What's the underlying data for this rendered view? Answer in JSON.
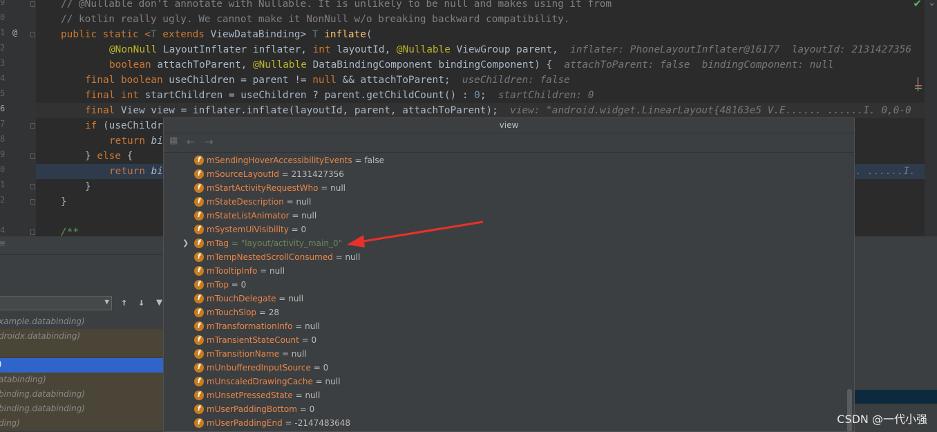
{
  "editor": {
    "line_numbers": [
      "9",
      "0",
      "1",
      "2",
      "3",
      "4",
      "5",
      "6",
      "7",
      "8",
      "9",
      "0",
      "1",
      "2",
      "3",
      "4"
    ],
    "gutter_marker": "@",
    "lines": {
      "l1": "// @Nullable don't annotate with Nullable. It is unlikely to be null and makes using it from",
      "l2": "// kotlin really ugly. We cannot make it NonNull w/o breaking backward compatibility.",
      "l3_a": "public static <",
      "l3_b": "T",
      "l3_c": " extends ",
      "l3_d": "ViewDataBinding> ",
      "l3_e": "T",
      "l3_f": " inflate",
      "l3_g": "(",
      "l4_a": "@NonNull",
      "l4_b": " LayoutInflater inflater, ",
      "l4_c": "int",
      "l4_d": " layoutId, ",
      "l4_e": "@Nullable",
      "l4_f": " ViewGroup parent,",
      "l4_hint": "inflater: PhoneLayoutInflater@16177  layoutId: 2131427356",
      "l5_a": "boolean",
      "l5_b": " attachToParent, ",
      "l5_c": "@Nullable",
      "l5_d": " DataBindingComponent bindingComponent) {",
      "l5_hint": "attachToParent: false  bindingComponent: null",
      "l6_a": "final boolean",
      "l6_b": " useChildren = parent != ",
      "l6_c": "null",
      "l6_d": " && attachToParent;",
      "l6_hint": "useChildren: false",
      "l7_a": "final int",
      "l7_b": " startChildren = useChildren ? parent.getChildCount() : ",
      "l7_c": "0",
      "l7_d": ";",
      "l7_hint": "startChildren: 0",
      "l8_a": "final",
      "l8_b": " View view = inflater.inflate(layoutId, parent, attachToParent);",
      "l8_hint": "view: \"android.widget.LinearLayout{48163e5 V.E...... ......I. 0,0-0",
      "l9_a": "if",
      "l9_b": " (useChildr",
      "l10_a": "return",
      "l10_b": " bi",
      "l11_a": "} ",
      "l11_b": "else",
      "l11_c": " {",
      "l12_a": "return",
      "l12_b": " bi",
      "l12_hint": ". ......I.",
      "l13": "}",
      "l14": "}",
      "l16": "/**"
    }
  },
  "debug_panel": {
    "frames": [
      "xample.databinding)",
      "droidx.databinding)",
      "",
      ")",
      "atabinding)",
      "binding.databinding)",
      "binding.databinding)",
      "ding)"
    ]
  },
  "popup": {
    "title": "view",
    "fields": [
      {
        "name": "mSendingHoverAccessibilityEvents",
        "value": " = false"
      },
      {
        "name": "mSourceLayoutId",
        "value": " = 2131427356"
      },
      {
        "name": "mStartActivityRequestWho",
        "value": " = null"
      },
      {
        "name": "mStateDescription",
        "value": " = null"
      },
      {
        "name": "mStateListAnimator",
        "value": " = null"
      },
      {
        "name": "mSystemUiVisibility",
        "value": " = 0"
      },
      {
        "name": "mTag",
        "value": " = \"layout/activity_main_0\""
      },
      {
        "name": "mTempNestedScrollConsumed",
        "value": " = null"
      },
      {
        "name": "mTooltipInfo",
        "value": " = null"
      },
      {
        "name": "mTop",
        "value": " = 0"
      },
      {
        "name": "mTouchDelegate",
        "value": " = null"
      },
      {
        "name": "mTouchSlop",
        "value": " = 28"
      },
      {
        "name": "mTransformationInfo",
        "value": " = null"
      },
      {
        "name": "mTransientStateCount",
        "value": " = 0"
      },
      {
        "name": "mTransitionName",
        "value": " = null"
      },
      {
        "name": "mUnbufferedInputSource",
        "value": " = 0"
      },
      {
        "name": "mUnscaledDrawingCache",
        "value": " = null"
      },
      {
        "name": "mUnsetPressedState",
        "value": " = null"
      },
      {
        "name": "mUserPaddingBottom",
        "value": " = 0"
      },
      {
        "name": "mUserPaddingEnd",
        "value": " = -2147483648"
      }
    ],
    "field_icon_letter": "f"
  },
  "watermark": "CSDN @一代小强",
  "colors": {
    "annotation_arrow": "#e8312a",
    "field_icon": "#c97c1f",
    "selected_frame": "#2f65ca"
  }
}
